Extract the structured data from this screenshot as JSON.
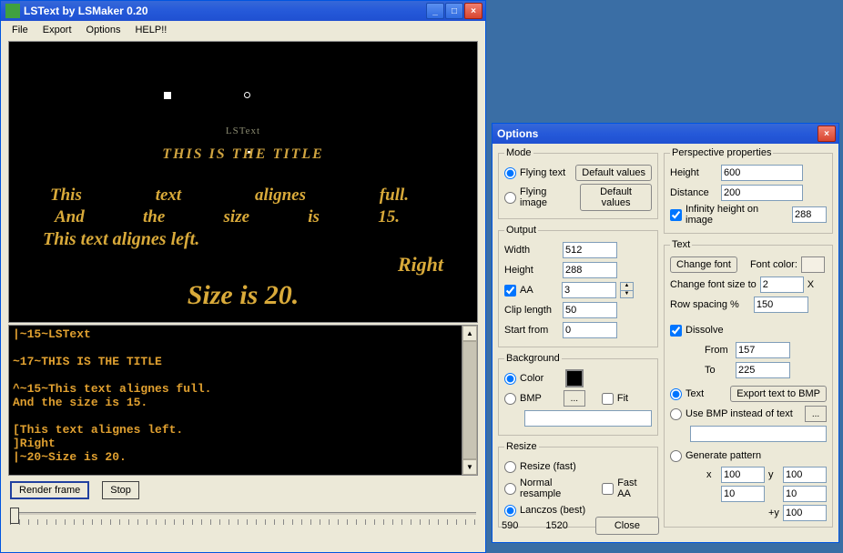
{
  "main_window": {
    "title": "LSText by LSMaker 0.20",
    "menu": {
      "file": "File",
      "export": "Export",
      "options": "Options",
      "help": "HELP!!"
    }
  },
  "preview": {
    "line1": "LSText",
    "line2": "THIS IS THE TITLE",
    "line3": {
      "w1": "This",
      "w2": "text",
      "w3": "alignes",
      "w4": "full."
    },
    "line4": {
      "w1": "And",
      "w2": "the",
      "w3": "size",
      "w4": "is",
      "w5": "15."
    },
    "line5": "This text alignes left.",
    "line6": "Right",
    "line7": "Size is 20."
  },
  "editor": "|~15~LSText\n\n~17~THIS IS THE TITLE\n\n^~15~This text alignes full.\nAnd the size is 15.\n\n[This text alignes left.\n]Right\n|~20~Size is 20.",
  "buttons": {
    "render": "Render frame",
    "stop": "Stop"
  },
  "options": {
    "title": "Options",
    "mode": {
      "legend": "Mode",
      "flying_text": "Flying text",
      "flying_image": "Flying image",
      "default_values": "Default values"
    },
    "output": {
      "legend": "Output",
      "width_label": "Width",
      "width": "512",
      "height_label": "Height",
      "height": "288",
      "aa_label": "AA",
      "aa": "3",
      "clip_label": "Clip length",
      "clip": "50",
      "start_label": "Start from",
      "start": "0"
    },
    "background": {
      "legend": "Background",
      "color_label": "Color",
      "bmp_label": "BMP",
      "fit_label": "Fit"
    },
    "resize": {
      "legend": "Resize",
      "fast": "Resize (fast)",
      "normal": "Normal resample",
      "lanczos": "Lanczos (best)",
      "fast_aa": "Fast AA"
    },
    "perspective": {
      "legend": "Perspective properties",
      "height_label": "Height",
      "height": "600",
      "distance_label": "Distance",
      "distance": "200",
      "infinity": "Infinity height on image",
      "infinity_val": "288"
    },
    "text": {
      "legend": "Text",
      "change_font": "Change font",
      "font_color_label": "Font color:",
      "change_size_label": "Change font size to",
      "size_val": "2",
      "x": "X",
      "row_spacing_label": "Row spacing %",
      "row_spacing": "150",
      "dissolve": "Dissolve",
      "from_label": "From",
      "from": "157",
      "to_label": "To",
      "to": "225",
      "text_radio": "Text",
      "export_bmp": "Export text to BMP",
      "use_bmp": "Use BMP instead of text",
      "gen_pattern": "Generate pattern",
      "x_lbl": "x",
      "y_lbl": "y",
      "plus_y": "+y",
      "x1": "100",
      "y1": "100",
      "x2": "10",
      "y2": "10",
      "y3": "100"
    },
    "status": {
      "a": "590",
      "b": "1520"
    },
    "close": "Close"
  }
}
